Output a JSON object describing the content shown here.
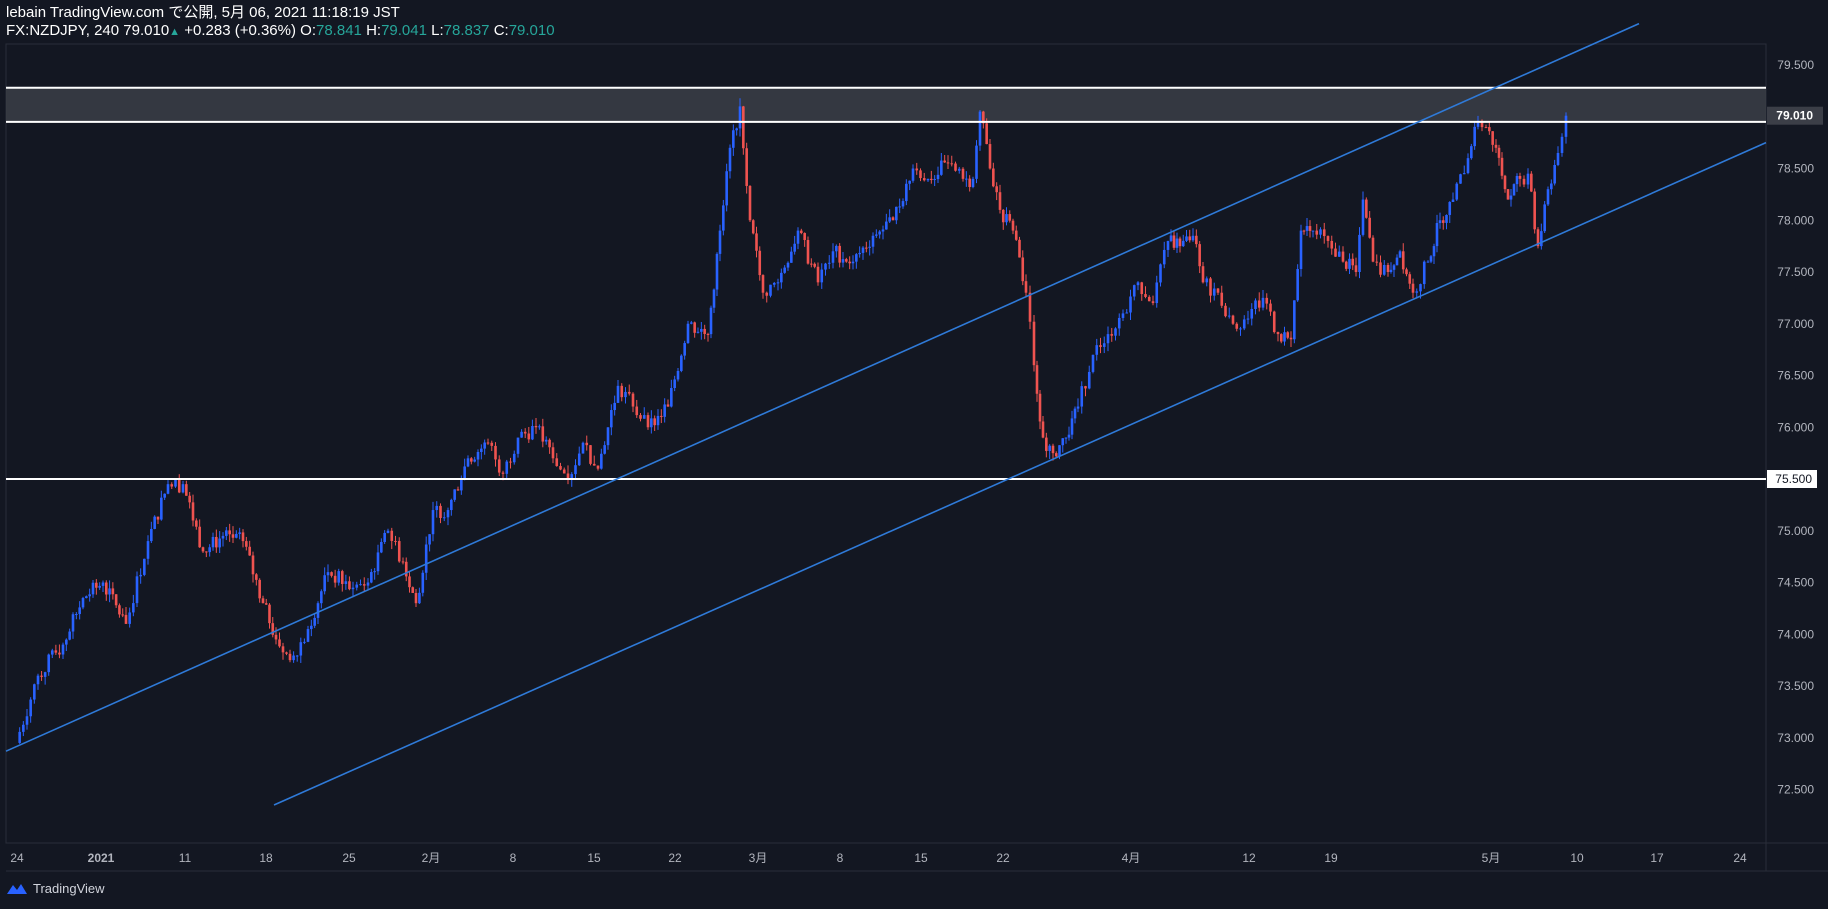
{
  "header": {
    "publish_line": "lebain TradingView.com で公開, 5月 06, 2021 11:18:19 JST",
    "symbol": "FX:NZDJPY, 240",
    "last": "79.010",
    "change": "+0.283 (+0.36%)",
    "open_label": "O:",
    "open": "78.841",
    "high_label": "H:",
    "high": "79.041",
    "low_label": "L:",
    "low": "78.837",
    "close_label": "C:",
    "close": "79.010"
  },
  "branding": {
    "logo_text": "TradingView"
  },
  "colors": {
    "background": "#131722",
    "candle_up": "#2962ff",
    "candle_down": "#ef5350",
    "trendline": "#2f7ad8",
    "hline": "#ffffff",
    "zone": "#3b3e47"
  },
  "chart_data": {
    "type": "candlestick",
    "symbol": "FX:NZDJPY",
    "timeframe": "240",
    "ylim": [
      72.35,
      79.9
    ],
    "y_ticks": [
      "72.500",
      "73.000",
      "73.500",
      "74.000",
      "74.500",
      "75.000",
      "75.500",
      "76.000",
      "76.500",
      "77.000",
      "77.500",
      "78.000",
      "78.500",
      "79.000",
      "79.500"
    ],
    "x_ticks": [
      "24",
      "2021",
      "11",
      "18",
      "25",
      "2月",
      "8",
      "15",
      "22",
      "3月",
      "8",
      "15",
      "22",
      "4月",
      "12",
      "19",
      "5月",
      "10",
      "17",
      "24"
    ],
    "price_labels": [
      {
        "value": 79.01,
        "text": "79.010",
        "style": "current"
      },
      {
        "value": 75.5,
        "text": "75.500",
        "style": "line"
      }
    ],
    "horizontal_lines": [
      75.5,
      78.95,
      79.28
    ],
    "zone": [
      78.95,
      79.28
    ],
    "trendlines": [
      {
        "from": {
          "x": 0,
          "price": 72.87
        },
        "to": {
          "x": 1633,
          "price": 79.9
        }
      },
      {
        "from": {
          "x": 268,
          "price": 72.35
        },
        "to": {
          "x": 1760,
          "price": 78.75
        }
      }
    ],
    "series_close": [
      {
        "x": 8,
        "close": 72.95
      },
      {
        "x": 30,
        "close": 73.6
      },
      {
        "x": 55,
        "close": 73.9
      },
      {
        "x": 75,
        "close": 74.35
      },
      {
        "x": 95,
        "close": 74.5
      },
      {
        "x": 118,
        "close": 74.1
      },
      {
        "x": 140,
        "close": 74.9
      },
      {
        "x": 160,
        "close": 75.45
      },
      {
        "x": 175,
        "close": 75.45
      },
      {
        "x": 195,
        "close": 74.8
      },
      {
        "x": 215,
        "close": 74.95
      },
      {
        "x": 235,
        "close": 74.9
      },
      {
        "x": 255,
        "close": 74.3
      },
      {
        "x": 268,
        "close": 73.95
      },
      {
        "x": 282,
        "close": 73.75
      },
      {
        "x": 300,
        "close": 74.05
      },
      {
        "x": 320,
        "close": 74.6
      },
      {
        "x": 345,
        "close": 74.45
      },
      {
        "x": 360,
        "close": 74.5
      },
      {
        "x": 380,
        "close": 75.0
      },
      {
        "x": 395,
        "close": 74.7
      },
      {
        "x": 408,
        "close": 74.3
      },
      {
        "x": 425,
        "close": 75.2
      },
      {
        "x": 440,
        "close": 75.2
      },
      {
        "x": 460,
        "close": 75.7
      },
      {
        "x": 480,
        "close": 75.85
      },
      {
        "x": 495,
        "close": 75.55
      },
      {
        "x": 510,
        "close": 75.9
      },
      {
        "x": 528,
        "close": 76.0
      },
      {
        "x": 545,
        "close": 75.7
      },
      {
        "x": 560,
        "close": 75.5
      },
      {
        "x": 575,
        "close": 75.85
      },
      {
        "x": 590,
        "close": 75.6
      },
      {
        "x": 610,
        "close": 76.4
      },
      {
        "x": 625,
        "close": 76.2
      },
      {
        "x": 640,
        "close": 76.0
      },
      {
        "x": 660,
        "close": 76.2
      },
      {
        "x": 680,
        "close": 77.0
      },
      {
        "x": 700,
        "close": 76.9
      },
      {
        "x": 712,
        "close": 77.9
      },
      {
        "x": 722,
        "close": 78.7
      },
      {
        "x": 732,
        "close": 79.1
      },
      {
        "x": 742,
        "close": 78.0
      },
      {
        "x": 755,
        "close": 77.3
      },
      {
        "x": 770,
        "close": 77.4
      },
      {
        "x": 790,
        "close": 77.9
      },
      {
        "x": 810,
        "close": 77.4
      },
      {
        "x": 825,
        "close": 77.7
      },
      {
        "x": 845,
        "close": 77.6
      },
      {
        "x": 865,
        "close": 77.85
      },
      {
        "x": 885,
        "close": 78.0
      },
      {
        "x": 905,
        "close": 78.5
      },
      {
        "x": 920,
        "close": 78.4
      },
      {
        "x": 940,
        "close": 78.55
      },
      {
        "x": 955,
        "close": 78.4
      },
      {
        "x": 965,
        "close": 78.4
      },
      {
        "x": 972,
        "close": 79.05
      },
      {
        "x": 982,
        "close": 78.5
      },
      {
        "x": 992,
        "close": 78.1
      },
      {
        "x": 1005,
        "close": 77.9
      },
      {
        "x": 1018,
        "close": 77.3
      },
      {
        "x": 1026,
        "close": 76.6
      },
      {
        "x": 1035,
        "close": 75.9
      },
      {
        "x": 1045,
        "close": 75.75
      },
      {
        "x": 1058,
        "close": 75.9
      },
      {
        "x": 1070,
        "close": 76.2
      },
      {
        "x": 1085,
        "close": 76.7
      },
      {
        "x": 1100,
        "close": 76.9
      },
      {
        "x": 1115,
        "close": 77.1
      },
      {
        "x": 1130,
        "close": 77.4
      },
      {
        "x": 1145,
        "close": 77.2
      },
      {
        "x": 1160,
        "close": 77.8
      },
      {
        "x": 1172,
        "close": 77.75
      },
      {
        "x": 1185,
        "close": 77.85
      },
      {
        "x": 1195,
        "close": 77.4
      },
      {
        "x": 1210,
        "close": 77.3
      },
      {
        "x": 1225,
        "close": 77.0
      },
      {
        "x": 1240,
        "close": 77.05
      },
      {
        "x": 1255,
        "close": 77.25
      },
      {
        "x": 1270,
        "close": 76.9
      },
      {
        "x": 1283,
        "close": 76.85
      },
      {
        "x": 1293,
        "close": 77.9
      },
      {
        "x": 1305,
        "close": 77.9
      },
      {
        "x": 1320,
        "close": 77.8
      },
      {
        "x": 1335,
        "close": 77.6
      },
      {
        "x": 1348,
        "close": 77.5
      },
      {
        "x": 1355,
        "close": 78.2
      },
      {
        "x": 1365,
        "close": 77.6
      },
      {
        "x": 1380,
        "close": 77.5
      },
      {
        "x": 1392,
        "close": 77.7
      },
      {
        "x": 1405,
        "close": 77.3
      },
      {
        "x": 1420,
        "close": 77.6
      },
      {
        "x": 1432,
        "close": 78.0
      },
      {
        "x": 1445,
        "close": 78.2
      },
      {
        "x": 1460,
        "close": 78.6
      },
      {
        "x": 1470,
        "close": 78.95
      },
      {
        "x": 1478,
        "close": 78.9
      },
      {
        "x": 1488,
        "close": 78.7
      },
      {
        "x": 1500,
        "close": 78.2
      },
      {
        "x": 1512,
        "close": 78.4
      },
      {
        "x": 1520,
        "close": 78.45
      },
      {
        "x": 1530,
        "close": 77.75
      },
      {
        "x": 1540,
        "close": 78.3
      },
      {
        "x": 1550,
        "close": 78.65
      },
      {
        "x": 1558,
        "close": 79.01
      }
    ]
  }
}
